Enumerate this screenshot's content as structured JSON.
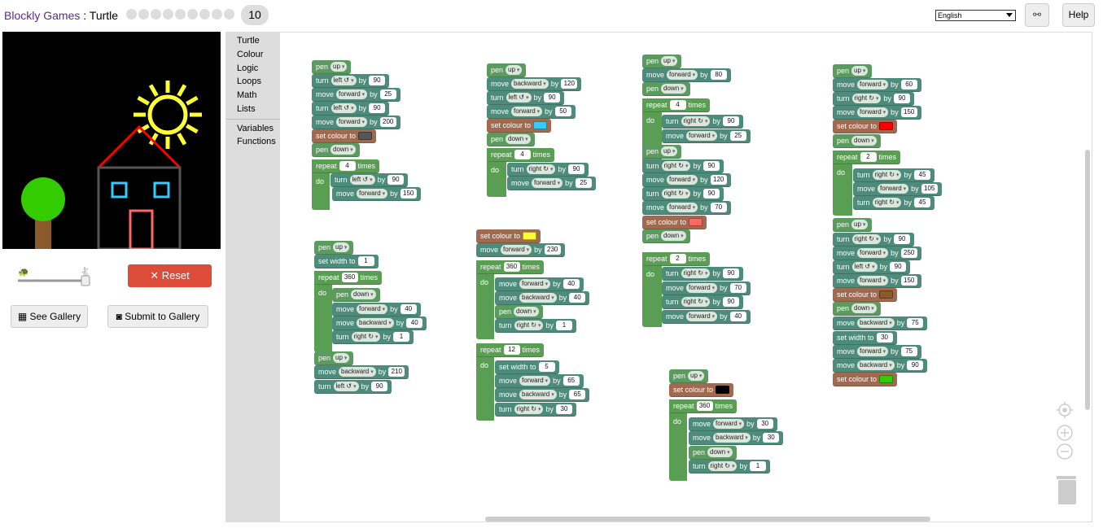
{
  "header": {
    "app_name": "Blockly Games",
    "separator": " : ",
    "game_name": "Turtle",
    "dots_count": 9,
    "level": "10",
    "language": "English",
    "link_icon": "link-icon",
    "help_label": "Help"
  },
  "controls": {
    "reset_label": "Reset",
    "reset_color": "#dd4b39",
    "gallery_label": "See Gallery",
    "submit_label": "Submit to Gallery",
    "speed_level": 1.0
  },
  "toolbox": {
    "items": [
      "Turtle",
      "Colour",
      "Logic",
      "Loops",
      "Math",
      "Lists"
    ],
    "items2": [
      "Variables",
      "Functions"
    ]
  },
  "blocks": [
    {
      "t": "pen",
      "words": [
        "pen"
      ],
      "dd": "up"
    },
    {
      "t": "mv",
      "words": [
        "turn"
      ],
      "dd": "left ↺",
      "by": "90"
    },
    {
      "t": "mv",
      "words": [
        "move"
      ],
      "dd": "forward",
      "by": "25"
    },
    {
      "t": "mv",
      "words": [
        "turn"
      ],
      "dd": "left ↺",
      "by": "90"
    },
    {
      "t": "mv",
      "words": [
        "move"
      ],
      "dd": "forward",
      "by": "200"
    },
    {
      "t": "col",
      "words": [
        "set colour to"
      ],
      "sw": "#555555"
    },
    {
      "t": "pen",
      "words": [
        "pen"
      ],
      "dd": "down"
    },
    {
      "t": "ctl",
      "words": [
        "repeat"
      ],
      "num": "4",
      "after": "times"
    },
    {
      "t": "mv",
      "words": [
        "turn"
      ],
      "dd": "left ↺",
      "by": "90"
    },
    {
      "t": "mv",
      "words": [
        "move"
      ],
      "dd": "forward",
      "by": "150"
    },
    {
      "t": "pen",
      "words": [
        "pen"
      ],
      "dd": "up"
    },
    {
      "t": "mv",
      "words": [
        "move"
      ],
      "dd": "backward",
      "by": "120"
    },
    {
      "t": "mv",
      "words": [
        "turn"
      ],
      "dd": "left ↺",
      "by": "90"
    },
    {
      "t": "mv",
      "words": [
        "move"
      ],
      "dd": "forward",
      "by": "50"
    },
    {
      "t": "col",
      "words": [
        "set colour to"
      ],
      "sw": "#33ccff"
    },
    {
      "t": "pen",
      "words": [
        "pen"
      ],
      "dd": "down"
    },
    {
      "t": "ctl",
      "words": [
        "repeat"
      ],
      "num": "4",
      "after": "times"
    },
    {
      "t": "mv",
      "words": [
        "turn"
      ],
      "dd": "right ↻",
      "by": "90"
    },
    {
      "t": "mv",
      "words": [
        "move"
      ],
      "dd": "forward",
      "by": "25"
    },
    {
      "t": "pen",
      "words": [
        "pen"
      ],
      "dd": "up"
    },
    {
      "t": "mv",
      "words": [
        "move"
      ],
      "dd": "forward",
      "by": "80"
    },
    {
      "t": "pen",
      "words": [
        "pen"
      ],
      "dd": "down"
    },
    {
      "t": "ctl",
      "words": [
        "repeat"
      ],
      "num": "4",
      "after": "times"
    },
    {
      "t": "mv",
      "words": [
        "turn"
      ],
      "dd": "right ↻",
      "by": "90"
    },
    {
      "t": "mv",
      "words": [
        "move"
      ],
      "dd": "forward",
      "by": "25"
    },
    {
      "t": "pen",
      "words": [
        "pen"
      ],
      "dd": "up"
    },
    {
      "t": "mv",
      "words": [
        "turn"
      ],
      "dd": "right ↻",
      "by": "90"
    },
    {
      "t": "mv",
      "words": [
        "move"
      ],
      "dd": "forward",
      "by": "120"
    },
    {
      "t": "mv",
      "words": [
        "turn"
      ],
      "dd": "right ↻",
      "by": "90"
    },
    {
      "t": "mv",
      "words": [
        "move"
      ],
      "dd": "forward",
      "by": "70"
    },
    {
      "t": "col",
      "words": [
        "set colour to"
      ],
      "sw": "#ff6666"
    },
    {
      "t": "pen",
      "words": [
        "pen"
      ],
      "dd": "down"
    },
    {
      "t": "ctl",
      "words": [
        "repeat"
      ],
      "num": "2",
      "after": "times"
    },
    {
      "t": "mv",
      "words": [
        "turn"
      ],
      "dd": "right ↻",
      "by": "90"
    },
    {
      "t": "mv",
      "words": [
        "move"
      ],
      "dd": "forward",
      "by": "70"
    },
    {
      "t": "mv",
      "words": [
        "turn"
      ],
      "dd": "right ↻",
      "by": "90"
    },
    {
      "t": "mv",
      "words": [
        "move"
      ],
      "dd": "forward",
      "by": "40"
    },
    {
      "t": "pen",
      "words": [
        "pen"
      ],
      "dd": "up"
    },
    {
      "t": "mv",
      "words": [
        "move"
      ],
      "dd": "forward",
      "by": "60"
    },
    {
      "t": "mv",
      "words": [
        "turn"
      ],
      "dd": "right ↻",
      "by": "90"
    },
    {
      "t": "mv",
      "words": [
        "move"
      ],
      "dd": "forward",
      "by": "150"
    },
    {
      "t": "col",
      "words": [
        "set colour to"
      ],
      "sw": "#ff0000"
    },
    {
      "t": "pen",
      "words": [
        "pen"
      ],
      "dd": "down"
    },
    {
      "t": "ctl",
      "words": [
        "repeat"
      ],
      "num": "2",
      "after": "times"
    },
    {
      "t": "mv",
      "words": [
        "turn"
      ],
      "dd": "right ↻",
      "by": "45"
    },
    {
      "t": "mv",
      "words": [
        "move"
      ],
      "dd": "forward",
      "by": "105"
    },
    {
      "t": "mv",
      "words": [
        "turn"
      ],
      "dd": "right ↻",
      "by": "45"
    },
    {
      "t": "pen",
      "words": [
        "pen"
      ],
      "dd": "up"
    },
    {
      "t": "mv",
      "words": [
        "turn"
      ],
      "dd": "right ↻",
      "by": "90"
    },
    {
      "t": "mv",
      "words": [
        "move"
      ],
      "dd": "forward",
      "by": "250"
    },
    {
      "t": "mv",
      "words": [
        "turn"
      ],
      "dd": "left ↺",
      "by": "90"
    },
    {
      "t": "mv",
      "words": [
        "move"
      ],
      "dd": "forward",
      "by": "150"
    },
    {
      "t": "col",
      "words": [
        "set colour to"
      ],
      "sw": "#8b5a2b"
    },
    {
      "t": "pen",
      "words": [
        "pen"
      ],
      "dd": "down"
    },
    {
      "t": "mv",
      "words": [
        "move"
      ],
      "dd": "backward",
      "by": "75"
    },
    {
      "t": "mv",
      "words": [
        "set width to"
      ],
      "num": "30"
    },
    {
      "t": "mv",
      "words": [
        "move"
      ],
      "dd": "forward",
      "by": "75"
    },
    {
      "t": "mv",
      "words": [
        "move"
      ],
      "dd": "backward",
      "by": "90"
    },
    {
      "t": "col",
      "words": [
        "set colour to"
      ],
      "sw": "#33cc00"
    },
    {
      "t": "pen",
      "words": [
        "pen"
      ],
      "dd": "up"
    },
    {
      "t": "mv",
      "words": [
        "set width to"
      ],
      "num": "1"
    },
    {
      "t": "ctl",
      "words": [
        "repeat"
      ],
      "num": "360",
      "after": "times"
    },
    {
      "t": "pen",
      "words": [
        "pen"
      ],
      "dd": "down"
    },
    {
      "t": "mv",
      "words": [
        "move"
      ],
      "dd": "forward",
      "by": "40"
    },
    {
      "t": "mv",
      "words": [
        "move"
      ],
      "dd": "backward",
      "by": "40"
    },
    {
      "t": "mv",
      "words": [
        "turn"
      ],
      "dd": "right ↻",
      "by": "1"
    },
    {
      "t": "pen",
      "words": [
        "pen"
      ],
      "dd": "up"
    },
    {
      "t": "mv",
      "words": [
        "move"
      ],
      "dd": "backward",
      "by": "210"
    },
    {
      "t": "mv",
      "words": [
        "turn"
      ],
      "dd": "left ↺",
      "by": "90"
    },
    {
      "t": "col",
      "words": [
        "set colour to"
      ],
      "sw": "#ffff33"
    },
    {
      "t": "mv",
      "words": [
        "move"
      ],
      "dd": "forward",
      "by": "230"
    },
    {
      "t": "ctl",
      "words": [
        "repeat"
      ],
      "num": "360",
      "after": "times"
    },
    {
      "t": "mv",
      "words": [
        "move"
      ],
      "dd": "forward",
      "by": "40"
    },
    {
      "t": "mv",
      "words": [
        "move"
      ],
      "dd": "backward",
      "by": "40"
    },
    {
      "t": "pen",
      "words": [
        "pen"
      ],
      "dd": "down"
    },
    {
      "t": "mv",
      "words": [
        "turn"
      ],
      "dd": "right ↻",
      "by": "1"
    },
    {
      "t": "ctl",
      "words": [
        "repeat"
      ],
      "num": "12",
      "after": "times"
    },
    {
      "t": "mv",
      "words": [
        "set width to"
      ],
      "num": "5"
    },
    {
      "t": "mv",
      "words": [
        "move"
      ],
      "dd": "forward",
      "by": "65"
    },
    {
      "t": "mv",
      "words": [
        "move"
      ],
      "dd": "backward",
      "by": "65"
    },
    {
      "t": "mv",
      "words": [
        "turn"
      ],
      "dd": "right ↻",
      "by": "30"
    },
    {
      "t": "pen",
      "words": [
        "pen"
      ],
      "dd": "up"
    },
    {
      "t": "col",
      "words": [
        "set colour to"
      ],
      "sw": "#000000"
    },
    {
      "t": "ctl",
      "words": [
        "repeat"
      ],
      "num": "360",
      "after": "times"
    },
    {
      "t": "mv",
      "words": [
        "move"
      ],
      "dd": "forward",
      "by": "30"
    },
    {
      "t": "mv",
      "words": [
        "move"
      ],
      "dd": "backward",
      "by": "30"
    },
    {
      "t": "pen",
      "words": [
        "pen"
      ],
      "dd": "down"
    },
    {
      "t": "mv",
      "words": [
        "turn"
      ],
      "dd": "right ↻",
      "by": "1"
    }
  ],
  "by_word": "by",
  "do_word": "do"
}
